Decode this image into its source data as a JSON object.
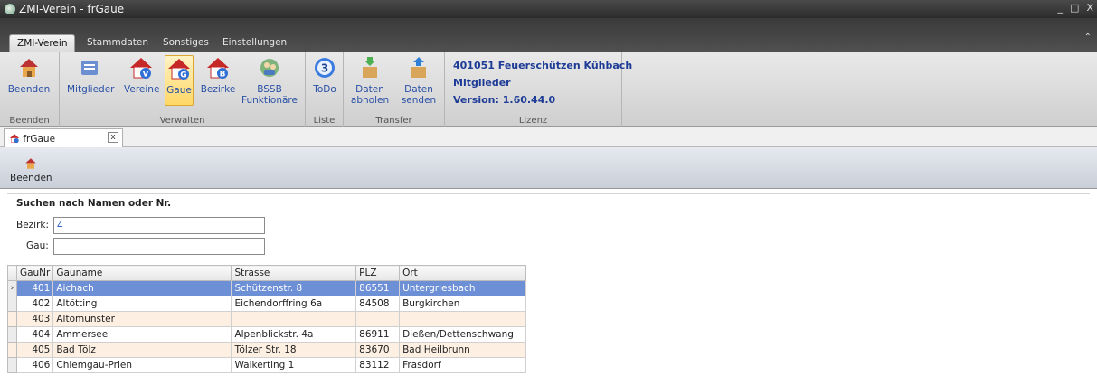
{
  "window": {
    "title": "ZMI-Verein - frGaue",
    "controls": [
      "_",
      "□",
      "X"
    ]
  },
  "ribbon_tabs": [
    "ZMI-Verein",
    "Stammdaten",
    "Sonstiges",
    "Einstellungen"
  ],
  "ribbon": {
    "groups": [
      {
        "label": "Beenden"
      },
      {
        "label": "Verwalten"
      },
      {
        "label": "Liste"
      },
      {
        "label": "Transfer"
      },
      {
        "label": "Lizenz"
      }
    ],
    "buttons": [
      {
        "label": "Beenden",
        "icon": "house-exit-icon"
      },
      {
        "label": "Mitglieder",
        "icon": "members-icon"
      },
      {
        "label": "Vereine",
        "icon": "house-v-icon"
      },
      {
        "label": "Gaue",
        "icon": "house-g-icon"
      },
      {
        "label": "Bezirke",
        "icon": "house-b-icon"
      },
      {
        "label": "BSSB Funktionäre",
        "icon": "officials-icon"
      },
      {
        "label": "ToDo",
        "icon": "todo-3-icon",
        "badge": "3"
      },
      {
        "label": "Daten abholen",
        "icon": "download-box-icon"
      },
      {
        "label": "Daten senden",
        "icon": "upload-box-icon"
      }
    ],
    "license": {
      "line1": "401051 Feuerschützen Kühbach",
      "line2": "Mitglieder",
      "line3": "Version: 1.60.44.0"
    }
  },
  "doc_tab": {
    "label": "frGaue",
    "close": "x"
  },
  "toolbar": {
    "beenden": "Beenden"
  },
  "search": {
    "header": "Suchen nach Namen oder Nr.",
    "bezirk_label": "Bezirk:",
    "bezirk_value": "4",
    "gau_label": "Gau:",
    "gau_value": ""
  },
  "grid": {
    "columns": [
      "GauNr",
      "Gauname",
      "Strasse",
      "PLZ",
      "Ort"
    ],
    "rows": [
      {
        "nr": "401",
        "name": "Aichach",
        "strasse": "Schützenstr. 8",
        "plz": "86551",
        "ort": "Untergriesbach"
      },
      {
        "nr": "402",
        "name": "Altötting",
        "strasse": "Eichendorffring 6a",
        "plz": "84508",
        "ort": "Burgkirchen"
      },
      {
        "nr": "403",
        "name": "Altomünster",
        "strasse": "",
        "plz": "",
        "ort": ""
      },
      {
        "nr": "404",
        "name": "Ammersee",
        "strasse": "Alpenblickstr. 4a",
        "plz": "86911",
        "ort": "Dießen/Dettenschwang"
      },
      {
        "nr": "405",
        "name": "Bad Tölz",
        "strasse": "Tölzer Str. 18",
        "plz": "83670",
        "ort": "Bad Heilbrunn"
      },
      {
        "nr": "406",
        "name": "Chiemgau-Prien",
        "strasse": "Walkerting 1",
        "plz": "83112",
        "ort": "Frasdorf"
      }
    ]
  },
  "colors": {
    "accent": "#2950a6",
    "selected_row": "#6d8fd6",
    "alt_row": "#fdf0e3"
  }
}
